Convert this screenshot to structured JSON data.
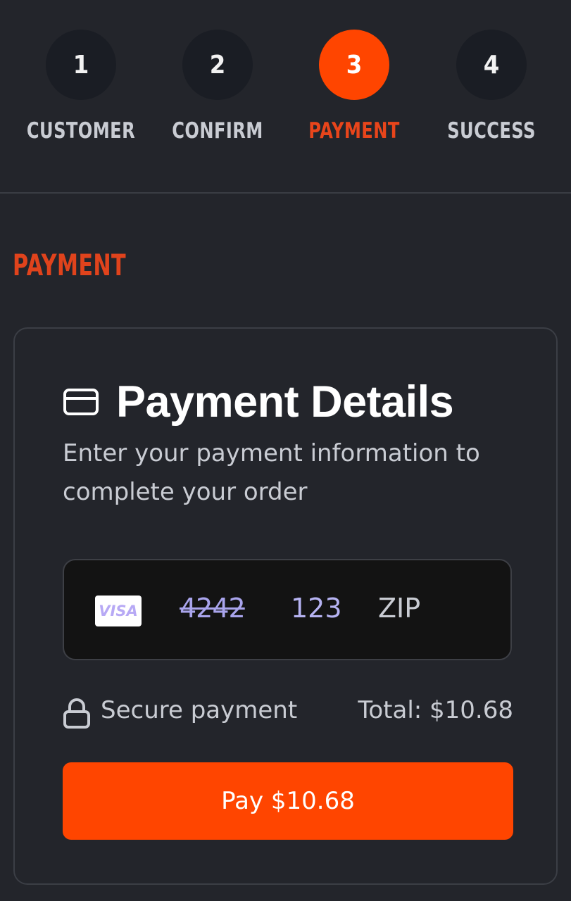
{
  "stepper": {
    "steps": [
      {
        "number": "1",
        "label": "CUSTOMER",
        "active": false
      },
      {
        "number": "2",
        "label": "CONFIRM",
        "active": false
      },
      {
        "number": "3",
        "label": "PAYMENT",
        "active": true
      },
      {
        "number": "4",
        "label": "SUCCESS",
        "active": false
      }
    ]
  },
  "section": {
    "title": "PAYMENT"
  },
  "card": {
    "title": "Payment Details",
    "title_icon": "credit-card-icon",
    "subtitle": "Enter your payment information to complete your order",
    "input": {
      "brand": "VISA",
      "card_number": "4242",
      "cvc": "123",
      "zip_placeholder": "ZIP"
    },
    "secure_label": "Secure payment",
    "secure_icon": "lock-icon",
    "total_label": "Total: $10.68",
    "pay_button": "Pay $10.68"
  },
  "colors": {
    "accent": "#ff4500",
    "background": "#23252b",
    "input_background": "#131313"
  }
}
